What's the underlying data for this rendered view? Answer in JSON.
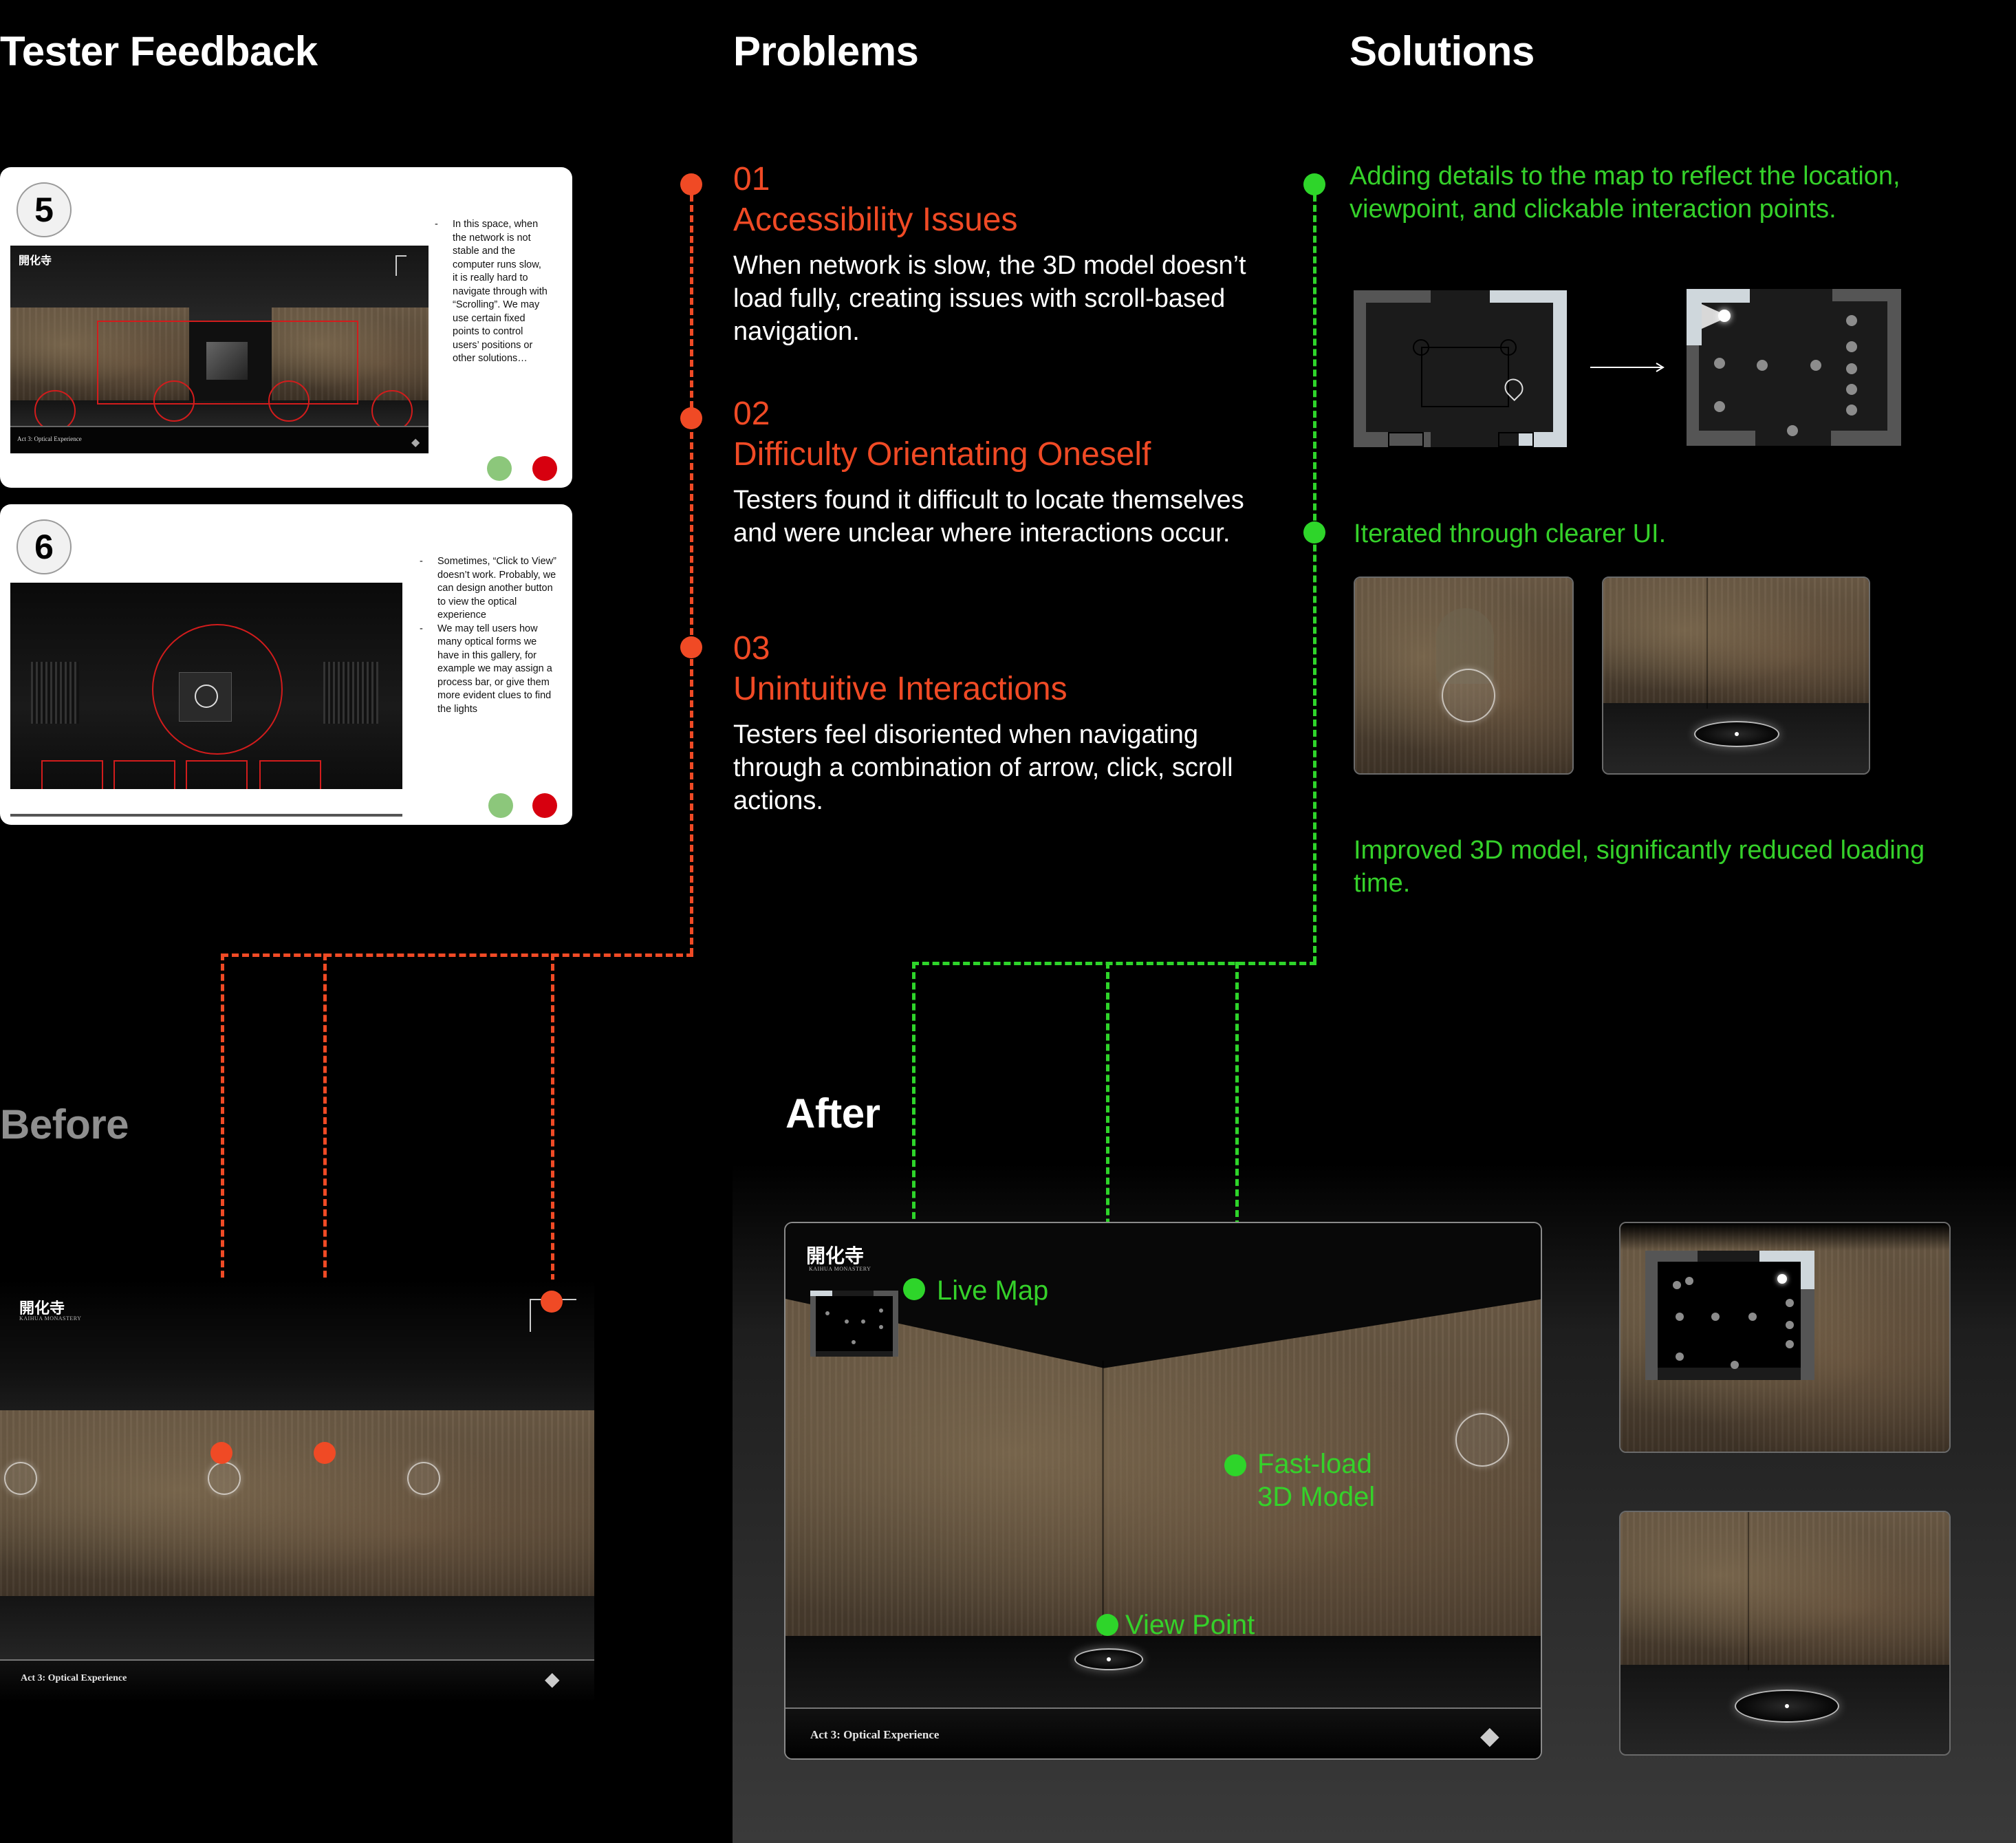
{
  "headers": {
    "feedback": "Tester Feedback",
    "problems": "Problems",
    "solutions": "Solutions",
    "before": "Before",
    "after": "After"
  },
  "feedback_cards": [
    {
      "number": "5",
      "notes": [
        "In this space, when the network is not stable and the computer runs slow, it is really hard to navigate through with “Scrolling”. We may use certain fixed points to control users’ positions or other solutions…"
      ],
      "footer": "Act 3: Optical Experience"
    },
    {
      "number": "6",
      "notes": [
        "Sometimes, “Click to View” doesn’t work. Probably, we can design another button to view the optical experience",
        "We may tell users how many optical forms we have in this gallery, for example we may assign a process bar, or give them more evident clues to find the lights"
      ]
    }
  ],
  "problems": [
    {
      "number": "01",
      "title": "Accessibility Issues",
      "description": "When network is slow, the 3D model doesn’t load fully, creating issues with scroll-based navigation."
    },
    {
      "number": "02",
      "title": "Difficulty Orientating Oneself",
      "description": "Testers found it difficult to locate themselves and were unclear where interactions occur."
    },
    {
      "number": "03",
      "title": "Unintuitive Interactions",
      "description": "Testers feel disoriented when navigating through a combination of arrow, click, scroll actions."
    }
  ],
  "solutions": [
    "Adding details to the map to reflect the location, viewpoint, and clickable interaction points.",
    "Iterated through clearer UI.",
    "Improved 3D model, significantly reduced loading time."
  ],
  "after_labels": {
    "live_map": "Live Map",
    "fast_load": "Fast-load\n3D Model",
    "view_point": "View Point"
  },
  "scene": {
    "logo": "開化寺",
    "logo_sub": "KAIHUA MONASTERY",
    "footer": "Act 3: Optical Experience"
  },
  "colors": {
    "problem_accent": "#f04a25",
    "solution_accent": "#2ed52a",
    "background": "#000000"
  },
  "icons": {
    "arrow": "long-right-arrow-icon",
    "footer_icon": "crystal-icon"
  }
}
